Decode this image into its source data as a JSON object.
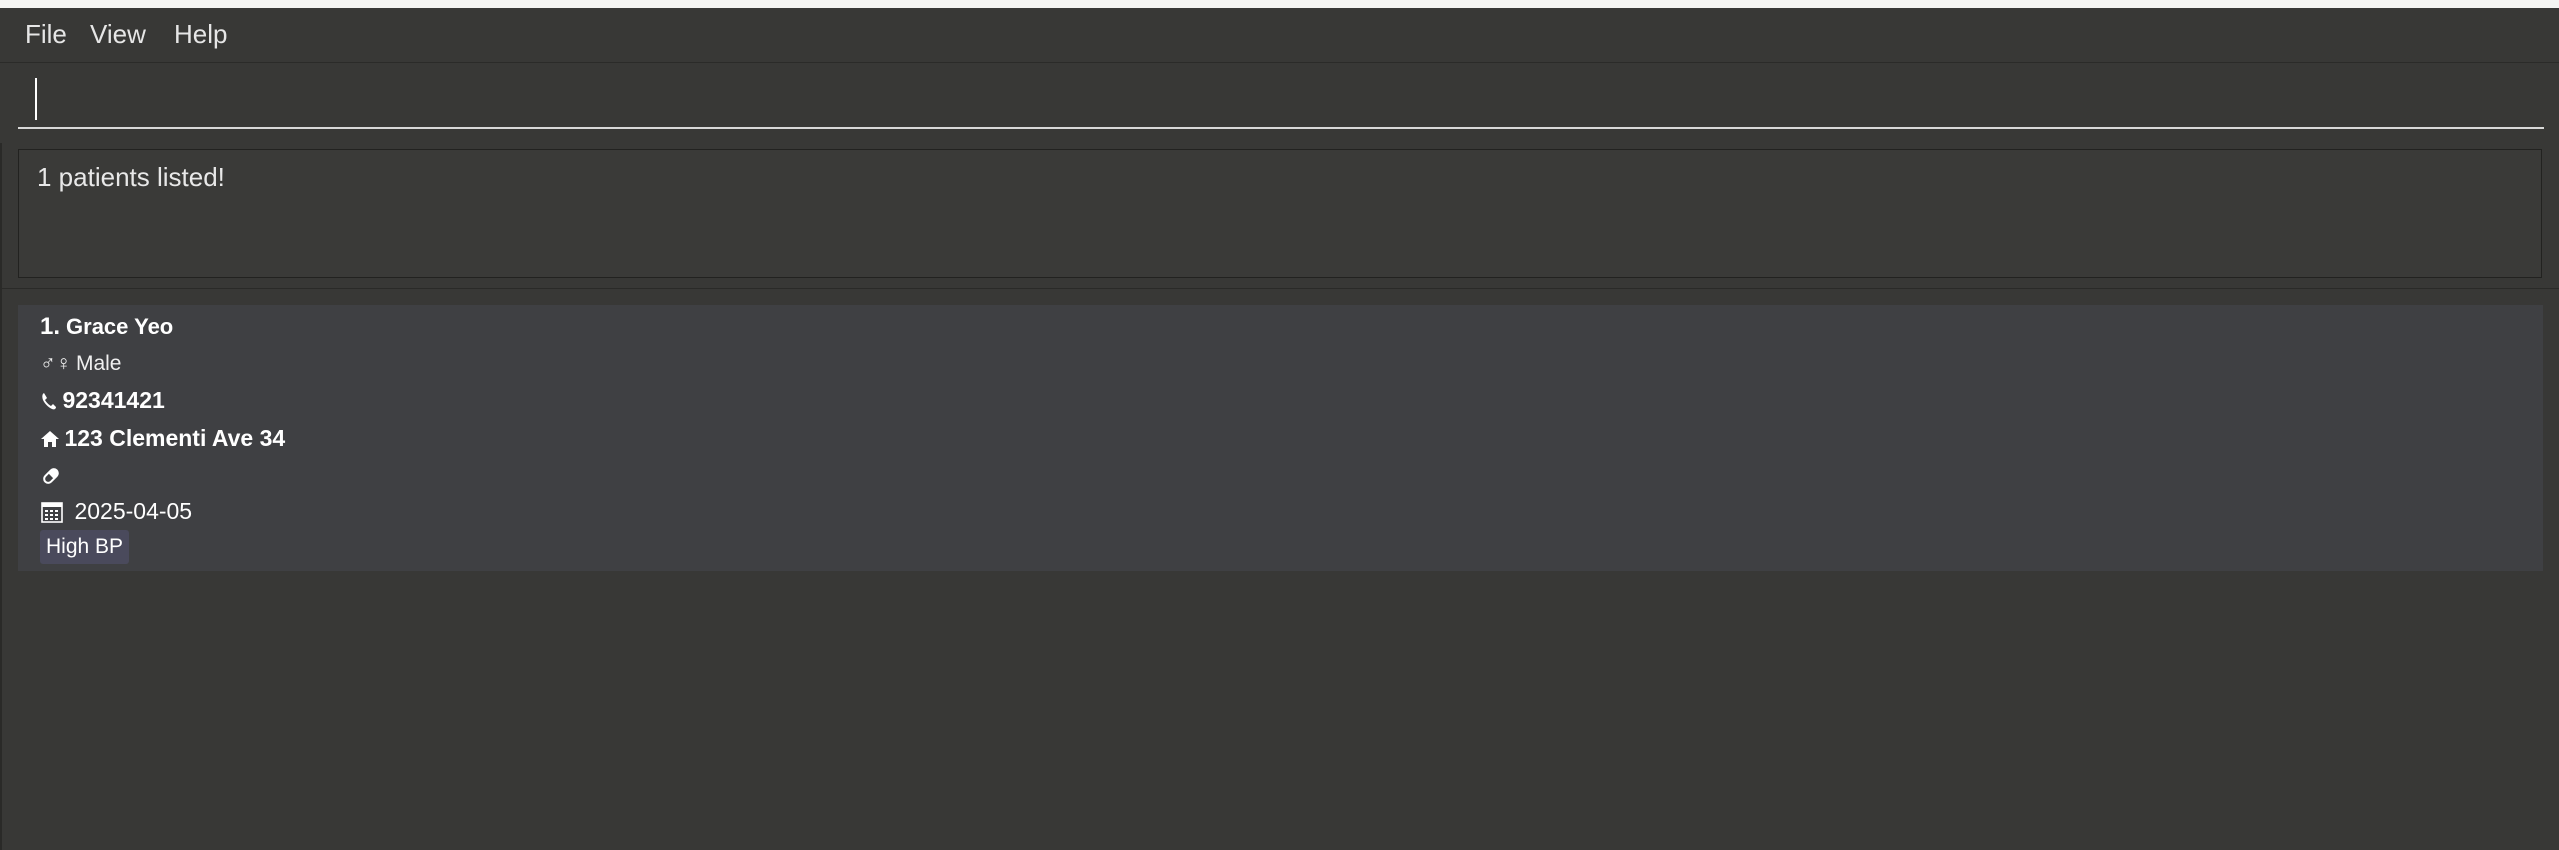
{
  "menu": {
    "file": "File",
    "view": "View",
    "help": "Help"
  },
  "command": {
    "value": "",
    "placeholder": ""
  },
  "result": {
    "message": "1 patients listed!"
  },
  "patients": [
    {
      "index": "1.",
      "name": "Grace Yeo",
      "gender_symbol": "♂♀",
      "gender": "Male",
      "phone": "92341421",
      "address": "123 Clementi Ave 34",
      "medication": "",
      "date": "2025-04-05",
      "tags": [
        "High BP"
      ]
    }
  ],
  "icons": {
    "phone": "phone-icon",
    "home": "home-icon",
    "pill": "pill-icon",
    "calendar": "calendar-icon"
  },
  "colors": {
    "background": "#383836",
    "card": "#3f4043",
    "tag": "#4a4a5c",
    "text": "#ffffff"
  }
}
